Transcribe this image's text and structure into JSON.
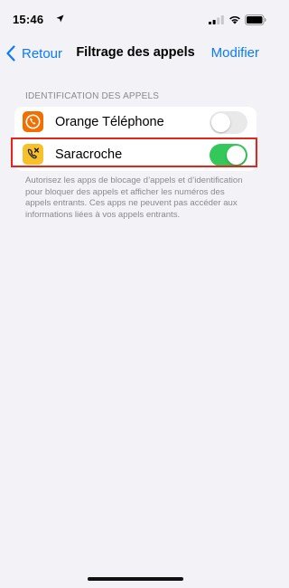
{
  "status_bar": {
    "time": "15:46",
    "icons": [
      "location-arrow-icon",
      "cellular-signal-icon",
      "wifi-icon",
      "battery-icon"
    ]
  },
  "nav": {
    "back_label": "Retour",
    "title": "Filtrage des appels",
    "edit_label": "Modifier"
  },
  "section": {
    "header": "IDENTIFICATION DES APPELS",
    "rows": [
      {
        "label": "Orange Téléphone",
        "icon": "orange-phone-app-icon",
        "icon_color": "#f16e00",
        "enabled": false
      },
      {
        "label": "Saracroche",
        "icon": "saracroche-app-icon",
        "icon_color": "#f7c12c",
        "enabled": true
      }
    ],
    "footer": "Autorisez les apps de blocage d’appels et d’identification pour bloquer des appels et afficher les numéros des appels entrants. Ces apps ne peuvent pas accéder aux informations liées à vos appels entrants."
  },
  "colors": {
    "accent": "#0a7aff",
    "toggle_on": "#34c759",
    "toggle_off": "#e9e9ea",
    "highlight": "#e2261c",
    "background": "#f2f2f7"
  }
}
